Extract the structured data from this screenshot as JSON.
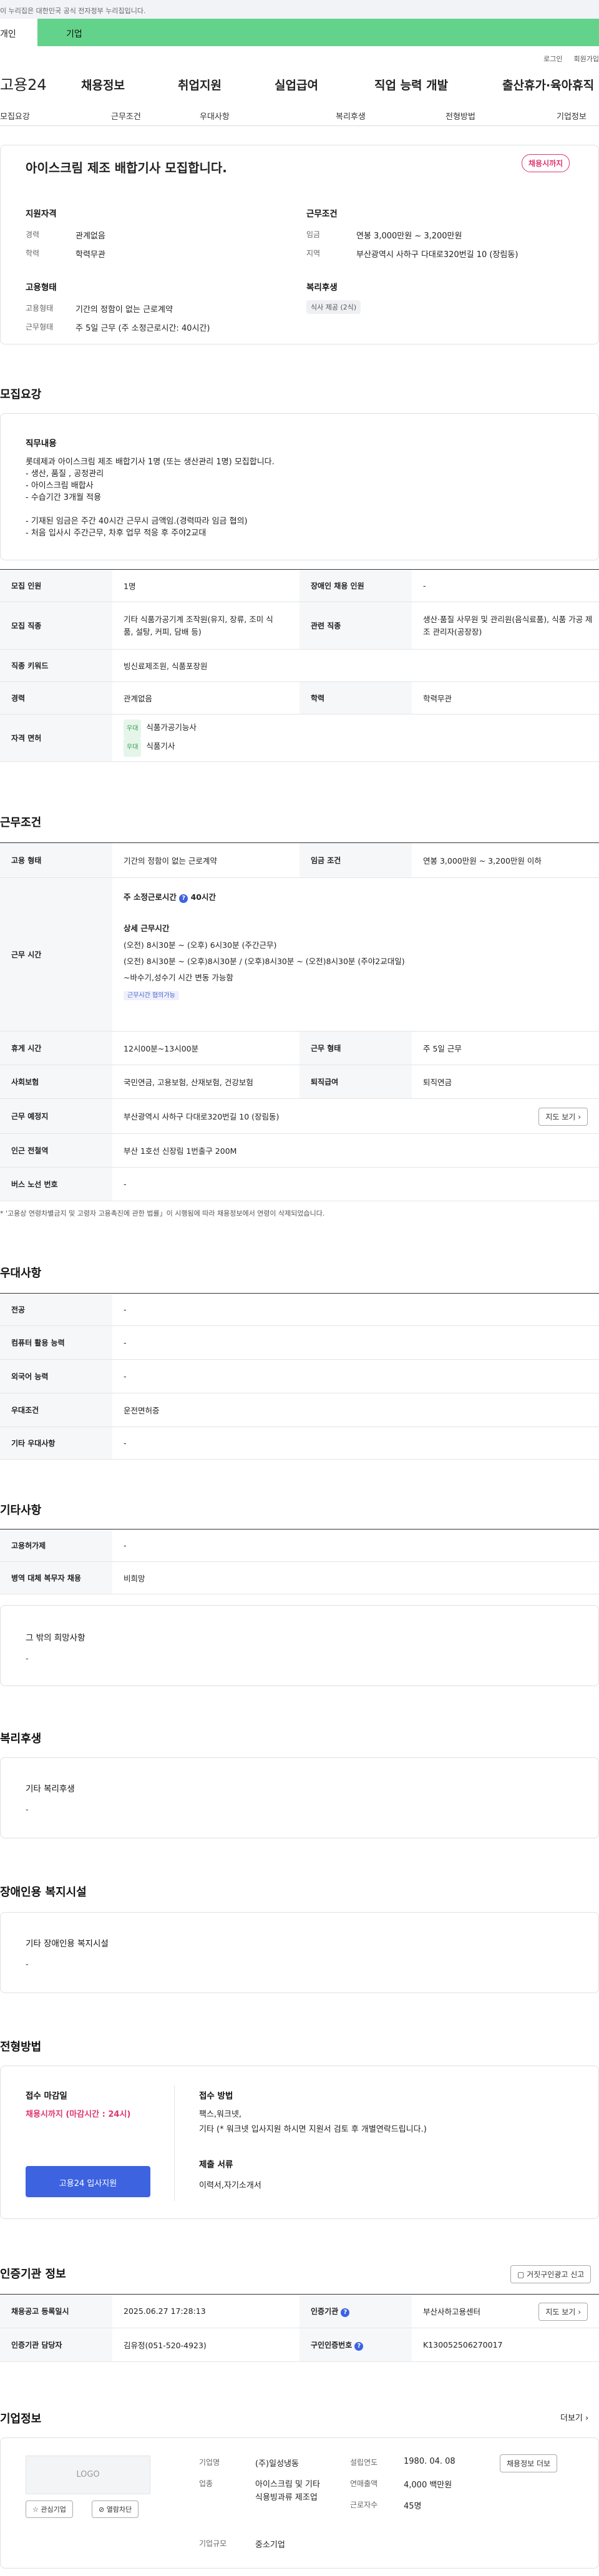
{
  "banner": {
    "text": "이 누리집은 대한민국 공식 전자정부 누리집입니다."
  },
  "site_tabs": {
    "personal": "개인",
    "company": "기업"
  },
  "util": {
    "login": "로그인",
    "join": "회원가입"
  },
  "gnb": {
    "logo": "고용24",
    "items": [
      "채용정보",
      "취업지원",
      "실업급여",
      "직업 능력 개발",
      "출산휴가·육아휴직"
    ]
  },
  "subnav": [
    "모집요강",
    "근무조건",
    "우대사항",
    "복리후생",
    "전형방법",
    "기업정보"
  ],
  "summary": {
    "title": "아이스크림 제조 배합기사 모집합니다.",
    "badge": "채용시까지",
    "qual_head": "지원자격",
    "cond_head": "근무조건",
    "career_l": "경력",
    "career_v": "관계없음",
    "edu_l": "학력",
    "edu_v": "학력무관",
    "wage_l": "임금",
    "wage_v": "연봉 3,000만원 ~ 3,200만원",
    "region_l": "지역",
    "region_v": "부산광역시 사하구 다대로320번길 10 (장림동)",
    "type_head": "고용형태",
    "welfare_head": "복리후생",
    "emp_l": "고용형태",
    "emp_v": "기간의 정함이 없는 근로계약",
    "work_l": "근무형태",
    "work_v": "주 5일 근무 (주 소정근로시간: 40시간)",
    "welfare_chip": "식사 제공 (2식)"
  },
  "recruit": {
    "heading": "모집요강",
    "duty_head": "직무내용",
    "duty_lines": [
      "롯데제과 아이스크림 제조 배합기사 1명 (또는 생산관리 1명) 모집합니다.",
      "- 생산, 품질 , 공정관리",
      "- 아이스크림 배합사",
      "- 수습기간 3개월 적용",
      "",
      "- 기재된 임금은 주간 40시간 근무시 금액임.(경력따라 임금 협의)",
      "- 처음 입사시 주간근무, 차후 업무 적응 후 주야2교대"
    ],
    "rows": {
      "count_l": "모집 인원",
      "count_v": "1명",
      "disabled_l": "장애인 채용 인원",
      "disabled_v": "-",
      "job_l": "모집 직종",
      "job_v": "기타 식품가공기계 조작원(유지, 장류, 조미 식품, 설탕, 커피, 담배 등)",
      "rel_l": "관련 직종",
      "rel_v": "생산·품질 사무원 및 관리원(음식료품), 식품 가공 제조 관리자(공장장)",
      "kw_l": "직종 키워드",
      "kw_v": "빙신료제조원, 식품포장원",
      "career_l": "경력",
      "career_v": "관계없음",
      "edu_l": "학력",
      "edu_v": "학력무관",
      "lic_l": "자격 면허",
      "lic_tag": "우대",
      "lic_1": "식품가공기능사",
      "lic_2": "식품기사"
    }
  },
  "condition": {
    "heading": "근무조건",
    "emp_l": "고용 형태",
    "emp_v": "기간의 정함이 없는 근로계약",
    "wage_l": "임금 조건",
    "wage_v": "연봉 3,000만원 ~ 3,200만원 이하",
    "time_l": "근무 시간",
    "time_head": "주 소정근로시간",
    "time_hours": "40시간",
    "detail_head": "상세 근무시간",
    "detail_lines": [
      "(오전) 8시30분 ~ (오후) 6시30분 (주간근무)",
      "(오전) 8시30분 ~ (오후)8시30분 / (오후)8시30분 ~ (오전)8시30분 (주야2교대일)",
      "~바수기,성수기  시간 변동 가능함"
    ],
    "time_chip": "근무시간 협의가능",
    "rest_l": "휴게 시간",
    "rest_v": "12시00분~13시00분",
    "shape_l": "근무 형태",
    "shape_v": "주 5일 근무",
    "ins_l": "사회보험",
    "ins_v": "국민연금, 고용보험, 산재보험, 건강보험",
    "retire_l": "퇴직급여",
    "retire_v": "퇴직연금",
    "place_l": "근무 예정지",
    "place_v": "부산광역시 사하구 다대로320번길 10 (장림동)",
    "map_btn": "지도 보기",
    "subway_l": "인근 전철역",
    "subway_v": "부산 1호선 신장림 1번출구 200M",
    "bus_l": "버스 노선 번호",
    "bus_v": "-",
    "note": "* '고용상 연령차별금지 및 고령자 고용촉진에 관한 법률」이 시행됨에 따라 채용정보에서 연령이 삭제되었습니다."
  },
  "pref": {
    "heading": "우대사항",
    "rows": [
      [
        "전공",
        "-"
      ],
      [
        "컴퓨터 활용 능력",
        "-"
      ],
      [
        "외국어 능력",
        "-"
      ],
      [
        "우대조건",
        "운전면허증"
      ],
      [
        "기타 우대사항",
        "-"
      ]
    ]
  },
  "etc": {
    "heading": "기타사항",
    "rows": [
      [
        "고용허가제",
        "-"
      ],
      [
        "병역 대체 복무자 채용",
        "비희망"
      ]
    ],
    "box_head": "그 밖의 희망사항",
    "box_v": "-"
  },
  "welfare": {
    "heading": "복리후생",
    "box_head": "기타 복리후생",
    "box_v": "-"
  },
  "disabled": {
    "heading": "장애인용 복지시설",
    "box_head": "기타 장애인용 복지시설",
    "box_v": "-"
  },
  "selection": {
    "heading": "전형방법",
    "deadline_head": "접수 마감일",
    "deadline_v": "채용시까지 (마감시간 : 24시)",
    "apply_btn": "고용24 입사지원",
    "method_head": "접수 방법",
    "method_lines": [
      "팩스,워크넷,",
      "기타 (* 워크넷 입사지원 하시면 지원서 검토 후 개별연락드립니다.)"
    ],
    "doc_head": "제출 서류",
    "doc_v": "이력서,자기소개서"
  },
  "agency": {
    "heading": "인증기관 정보",
    "report_btn": "거짓구인광고 신고",
    "reg_l": "채용공고 등록일시",
    "reg_v": "2025.06.27 17:28:13",
    "inst_l": "인증기관",
    "inst_v": "부산사하고용센터",
    "map_btn": "지도 보기",
    "mgr_l": "인증기관 담당자",
    "mgr_v": "김유정(051-520-4923)",
    "num_l": "구인인증번호",
    "num_v": "K130052506270017"
  },
  "company": {
    "heading": "기업정보",
    "more": "더보기",
    "logo": "LOGO",
    "fav": "관심기업",
    "block": "열람차단",
    "name_l": "기업명",
    "name_v": "(주)일성냉동",
    "biz_l": "업종",
    "biz_v": "아이스크림 및 기타 식용빙과류 제조업",
    "size_l": "기업규모",
    "size_v": "중소기업",
    "year_l": "설립연도",
    "year_v": "1980. 04. 08",
    "sales_l": "연매출액",
    "sales_v": "4,000 백만원",
    "emp_l": "근로자수",
    "emp_v": "45명",
    "job_btn": "채용정보 더보"
  }
}
